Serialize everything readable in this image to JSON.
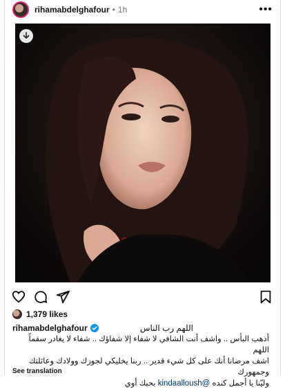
{
  "post": {
    "username": "rihamabdelghafour",
    "time": "1h",
    "dot": "•",
    "more_icon": "more-horizontal-icon"
  },
  "image": {
    "download_icon": "download-icon"
  },
  "actions": {
    "icons": [
      "heart-icon",
      "comment-icon",
      "share-icon",
      "bookmark-icon"
    ]
  },
  "likes": {
    "count": "1,379 likes"
  },
  "caption": {
    "username": "rihamabdelghafour",
    "line1": "اللهم رب الناس",
    "line2": "أذهب البأس .. واشف أنت الشافي لا شفاء إلا شفاؤك .. شفاء لا يغادر سقماً اللهم",
    "line3": "اشف مرضانا أنك على كل شيء قدير .. ربنا يخليكي لجوزك وولادك وعائلتك وجمهورك",
    "line4_prefix": "وليّنا يا أجمل كنده",
    "mention": "@kindaalloush",
    "line4_suffix": "بحبك أوي"
  },
  "translation": {
    "label": "See translation"
  },
  "colors": {
    "accent_ring": "#d62976",
    "verified": "#0095f6",
    "mention": "#00376b"
  }
}
